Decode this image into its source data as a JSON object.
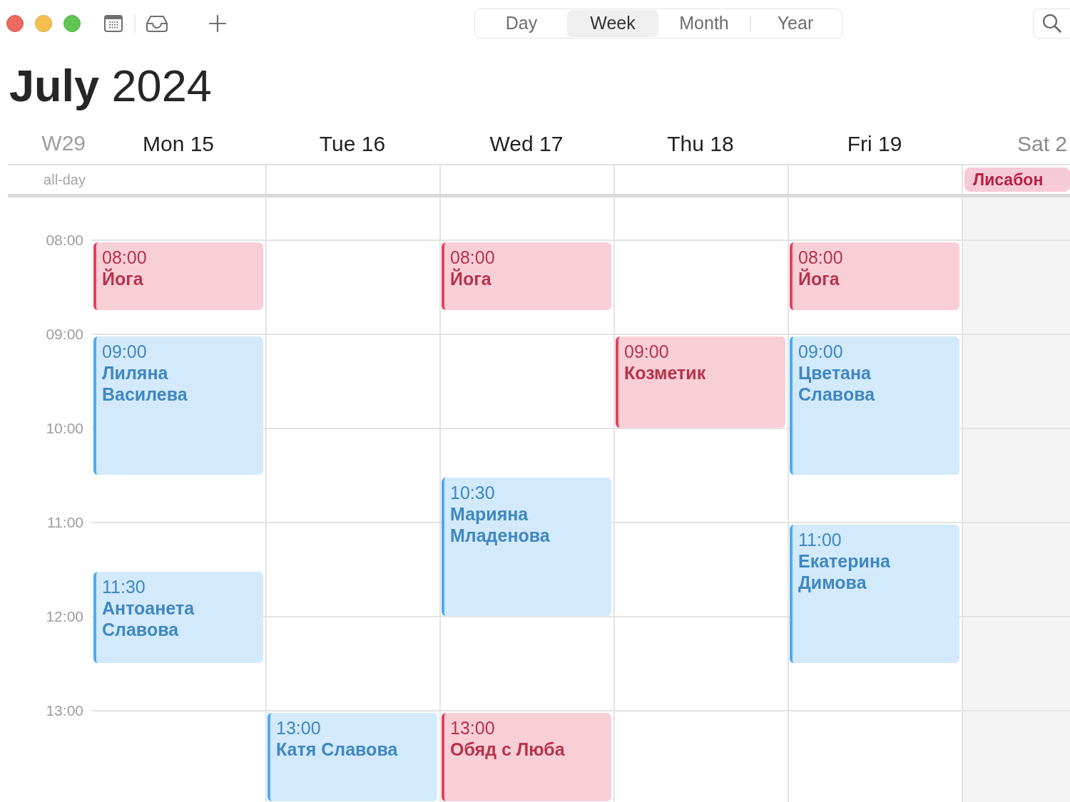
{
  "toolbar": {
    "view_tabs": [
      {
        "label": "Day",
        "selected": false
      },
      {
        "label": "Week",
        "selected": true
      },
      {
        "label": "Month",
        "selected": false
      },
      {
        "label": "Year",
        "selected": false
      }
    ]
  },
  "title": "**July** 2024",
  "week_label": "W29",
  "all_day_label": "all-day",
  "time_labels": [
    "08:00",
    "09:00",
    "10:00",
    "11:00",
    "12:00",
    "13:00"
  ],
  "days": [
    {
      "label": "Mon 15",
      "weekend": false,
      "events": [
        {
          "time": "08:00",
          "title": "Йога",
          "kind": "short",
          "color": "#e5405e"
        },
        {
          "time": "09:00",
          "title": "Лиляна Василева",
          "kind": "long",
          "color": "#4fa9f2"
        },
        {
          "time": "11:30",
          "title": "Антоанета Славова",
          "kind": "hour",
          "color": "#4fa9f2"
        }
      ]
    },
    {
      "label": "Tue 16",
      "weekend": false,
      "events": [
        {
          "time": "13:00",
          "title": "Катя Славова",
          "kind": "open",
          "color": "#4fa9f2"
        }
      ]
    },
    {
      "label": "Wed 17",
      "weekend": false,
      "events": [
        {
          "time": "08:00",
          "title": "Йога",
          "kind": "short",
          "color": "#e5405e"
        },
        {
          "time": "10:30",
          "title": "Марияна Младенова",
          "kind": "long",
          "color": "#4fa9f2"
        },
        {
          "time": "13:00",
          "title": "Обяд с Люба",
          "kind": "open",
          "color": "#e5405e"
        }
      ]
    },
    {
      "label": "Thu 18",
      "weekend": false,
      "events": [
        {
          "time": "09:00",
          "title": "Козметик",
          "kind": "hour",
          "color": "#e5405e"
        }
      ]
    },
    {
      "label": "Fri 19",
      "weekend": false,
      "events": [
        {
          "time": "08:00",
          "title": "Йога",
          "kind": "short",
          "color": "#e5405e"
        },
        {
          "time": "09:00",
          "title": "Цветана Славова",
          "kind": "long",
          "color": "#4fa9f2"
        },
        {
          "time": "11:00",
          "title": "Екатерина Димова",
          "kind": "long",
          "color": "#4fa9f2"
        }
      ]
    },
    {
      "label": "Sat 2",
      "weekend": true,
      "all_day": [
        {
          "title": "Лисабон",
          "color": "#f6cbd6"
        }
      ]
    }
  ]
}
